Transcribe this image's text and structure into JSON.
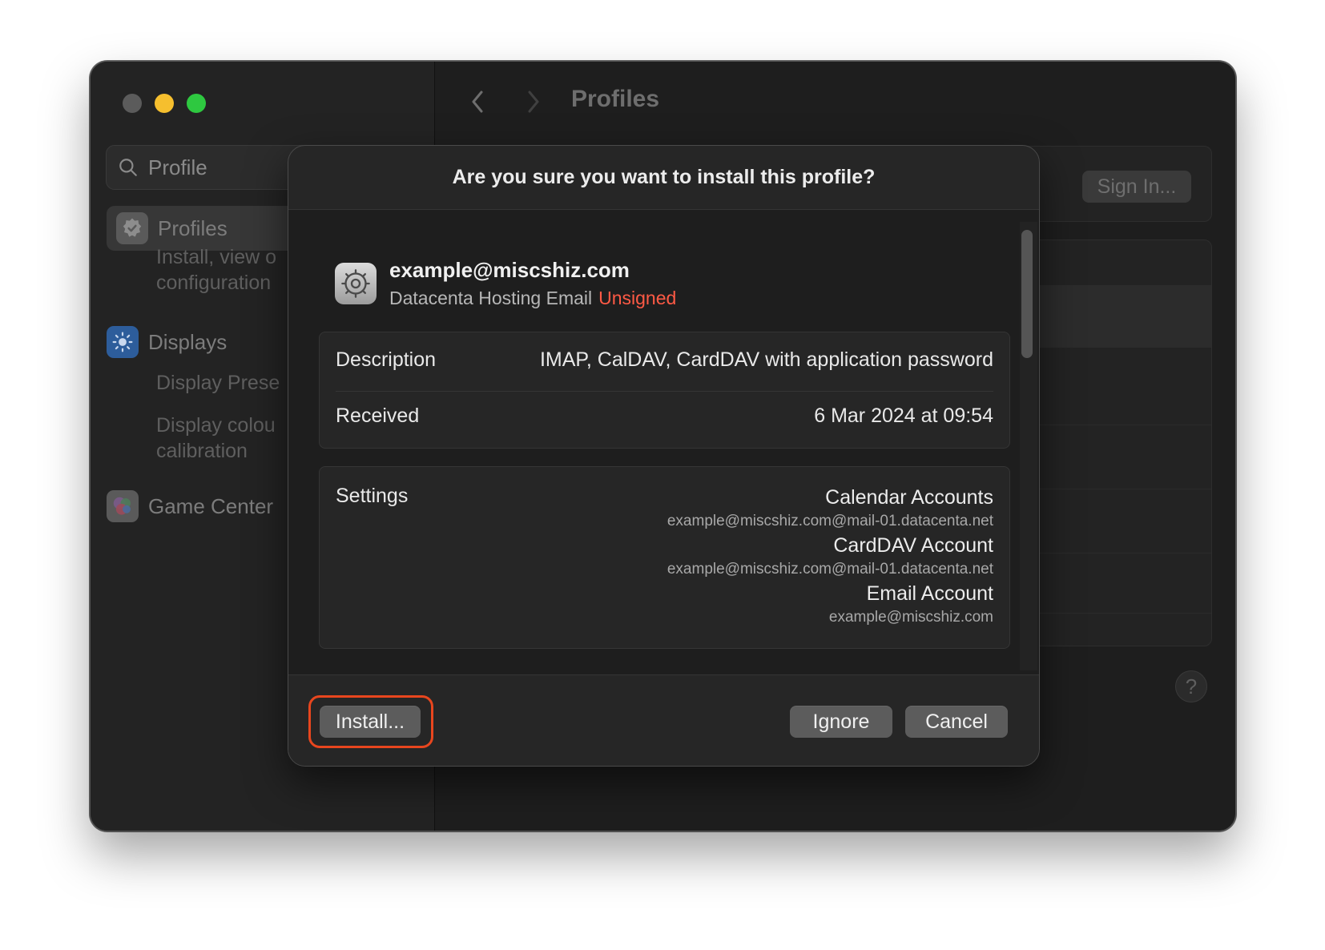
{
  "window": {
    "title": "Profiles",
    "search": {
      "placeholder": "Profile"
    },
    "sidebar": {
      "items": [
        {
          "label": "Profiles",
          "subitems": [
            "Install, view o\nconfiguration"
          ]
        },
        {
          "label": "Displays",
          "subitems": [
            "Display Prese",
            "Display colou\ncalibration"
          ]
        },
        {
          "label": "Game Center",
          "subitems": []
        }
      ]
    },
    "toolbar": {
      "back_icon": "chevron-left-icon",
      "forward_icon": "chevron-right-icon"
    },
    "sign_in_label": "Sign In...",
    "help_label": "?"
  },
  "dialog": {
    "title": "Are you sure you want to install this profile?",
    "profile": {
      "name": "example@miscshiz.com",
      "subtitle": "Datacenta Hosting Email",
      "status": "Unsigned",
      "icon": "gear-icon"
    },
    "details": {
      "description_label": "Description",
      "description_value": "IMAP, CalDAV, CardDAV with application password",
      "received_label": "Received",
      "received_value": "6 Mar 2024 at 09:54"
    },
    "settings": {
      "label": "Settings",
      "items": [
        {
          "name": "Calendar Accounts",
          "value": "example@miscshiz.com@mail-01.datacenta.net"
        },
        {
          "name": "CardDAV Account",
          "value": "example@miscshiz.com@mail-01.datacenta.net"
        },
        {
          "name": "Email Account",
          "value": "example@miscshiz.com"
        }
      ]
    },
    "buttons": {
      "install": "Install...",
      "ignore": "Ignore",
      "cancel": "Cancel"
    },
    "colors": {
      "unsigned": "#ff5a45",
      "highlight": "#e8461e"
    }
  }
}
